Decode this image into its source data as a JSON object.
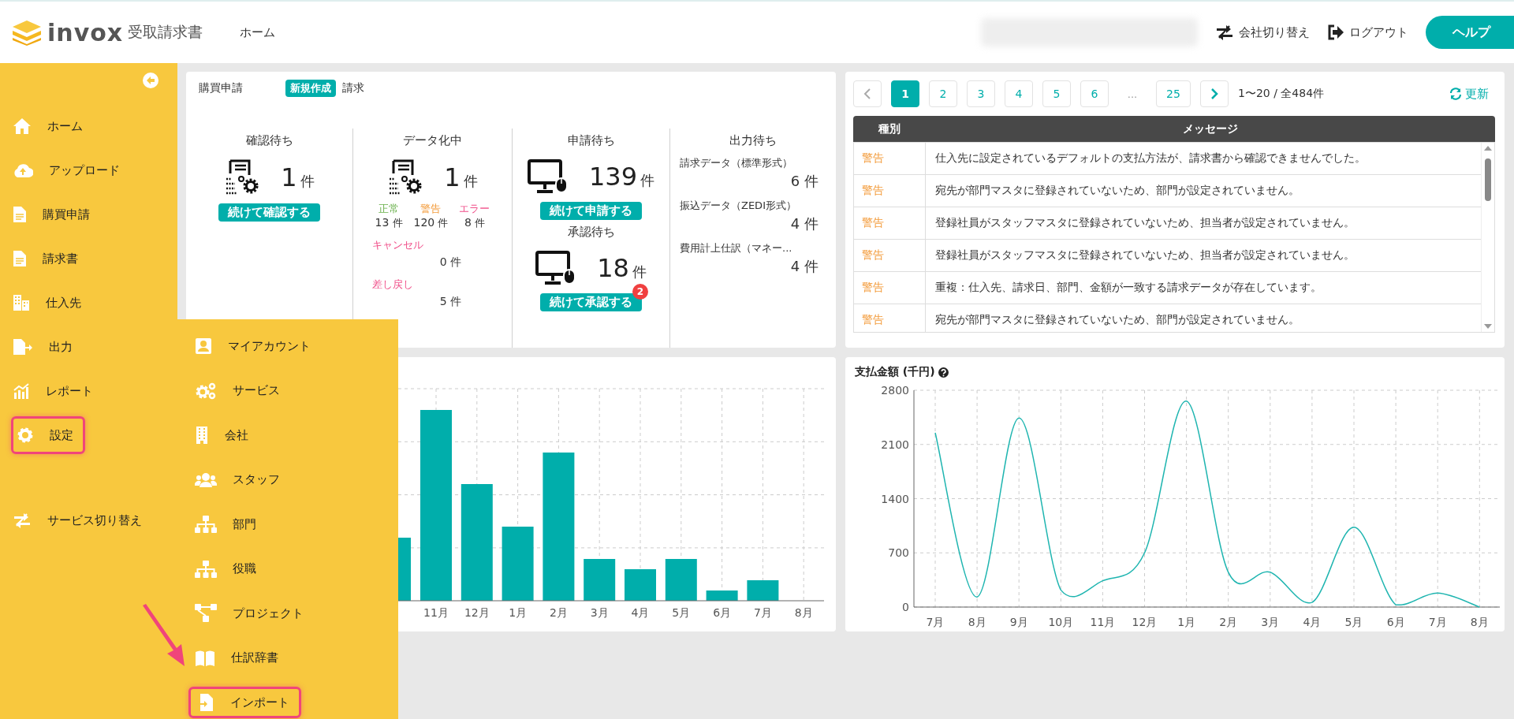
{
  "header": {
    "brand": "invox",
    "product": "受取請求書",
    "nav": [
      {
        "label": "ホーム"
      }
    ],
    "actions": [
      {
        "label": "会社切り替え",
        "kind": "switch"
      },
      {
        "label": "ログアウト",
        "kind": "logout"
      }
    ],
    "help_button": "ヘルプ"
  },
  "sidebar": {
    "items": [
      {
        "label": "ホーム",
        "kind": "home",
        "highlighted": false
      },
      {
        "label": "アップロード",
        "kind": "upload",
        "highlighted": false
      },
      {
        "label": "購買申請",
        "kind": "document",
        "highlighted": false
      },
      {
        "label": "請求書",
        "kind": "document",
        "highlighted": false
      },
      {
        "label": "仕入先",
        "kind": "buildings",
        "highlighted": false
      },
      {
        "label": "出力",
        "kind": "export",
        "highlighted": false
      },
      {
        "label": "レポート",
        "kind": "report",
        "highlighted": false
      },
      {
        "label": "設定",
        "kind": "gear",
        "highlighted": true
      },
      {
        "label": "サービス切り替え",
        "kind": "swap",
        "highlighted": false
      }
    ]
  },
  "settings_menu": {
    "items": [
      {
        "label": "マイアカウント",
        "kind": "account",
        "highlighted": false
      },
      {
        "label": "サービス",
        "kind": "gears",
        "highlighted": false
      },
      {
        "label": "会社",
        "kind": "office",
        "highlighted": false
      },
      {
        "label": "スタッフ",
        "kind": "staff",
        "highlighted": false
      },
      {
        "label": "部門",
        "kind": "org",
        "highlighted": false
      },
      {
        "label": "役職",
        "kind": "org",
        "highlighted": false
      },
      {
        "label": "プロジェクト",
        "kind": "project",
        "highlighted": false
      },
      {
        "label": "仕訳辞書",
        "kind": "book",
        "highlighted": false
      },
      {
        "label": "インポート",
        "kind": "import",
        "highlighted": true
      }
    ]
  },
  "purchase": {
    "title": "購買申請",
    "new_button": "新規作成",
    "status": "確認待ち",
    "count": "1",
    "unit": "件",
    "action": "続けて確認する"
  },
  "invoice": {
    "title": "請求",
    "digitizing": {
      "status": "データ化中",
      "count": "1",
      "unit": "件",
      "breakdown": [
        {
          "label": "正常",
          "count": "13",
          "unit": "件",
          "color": "#6ab04c"
        },
        {
          "label": "警告",
          "count": "120",
          "unit": "件",
          "color": "#f39c3c"
        },
        {
          "label": "エラー",
          "count": "8",
          "unit": "件",
          "color": "#f0508a"
        }
      ],
      "others": [
        {
          "label": "キャンセル",
          "count": "0",
          "unit": "件"
        },
        {
          "label": "差し戻し",
          "count": "5",
          "unit": "件"
        }
      ]
    },
    "awaiting_application": {
      "status": "申請待ち",
      "count": "139",
      "unit": "件",
      "action": "続けて申請する"
    },
    "awaiting_approval": {
      "status": "承認待ち",
      "count": "18",
      "unit": "件",
      "action": "続けて承認する",
      "badge": "2"
    },
    "awaiting_output": {
      "status": "出力待ち",
      "items": [
        {
          "label": "請求データ（標準形式）",
          "count": "6",
          "unit": "件"
        },
        {
          "label": "振込データ（ZEDI形式）",
          "count": "4",
          "unit": "件"
        },
        {
          "label": "費用計上仕訳（マネー...",
          "count": "4",
          "unit": "件"
        }
      ]
    }
  },
  "messages": {
    "pages": [
      {
        "label": "1",
        "kind": "page",
        "selected": true
      },
      {
        "label": "2",
        "kind": "page",
        "selected": false
      },
      {
        "label": "3",
        "kind": "page",
        "selected": false
      },
      {
        "label": "4",
        "kind": "page",
        "selected": false
      },
      {
        "label": "5",
        "kind": "page",
        "selected": false
      },
      {
        "label": "6",
        "kind": "page",
        "selected": false
      },
      {
        "label": "...",
        "kind": "ellipsis",
        "selected": false
      },
      {
        "label": "25",
        "kind": "page",
        "selected": false
      }
    ],
    "range": "1〜20 / 全484件",
    "refresh": "更新",
    "columns": [
      "種別",
      "メッセージ"
    ],
    "rows": [
      {
        "type": "警告",
        "message": "仕入先に設定されているデフォルトの支払方法が、請求書から確認できませんでした。"
      },
      {
        "type": "警告",
        "message": "宛先が部門マスタに登録されていないため、部門が設定されていません。"
      },
      {
        "type": "警告",
        "message": "登録社員がスタッフマスタに登録されていないため、担当者が設定されていません。"
      },
      {
        "type": "警告",
        "message": "登録社員がスタッフマスタに登録されていないため、担当者が設定されていません。"
      },
      {
        "type": "警告",
        "message": "重複：仕入先、請求日、部門、金額が一致する請求データが存在しています。"
      },
      {
        "type": "警告",
        "message": "宛先が部門マスタに登録されていないため、部門が設定されていません。"
      }
    ]
  },
  "bar_chart": {
    "x_labels": [
      "11月",
      "12月",
      "1月",
      "2月",
      "3月",
      "4月",
      "5月",
      "6月",
      "7月",
      "8月"
    ]
  },
  "payment_chart": {
    "chart_data": {
      "type": "line",
      "title": "支払金額 (千円)",
      "categories": [
        "7月",
        "8月",
        "9月",
        "10月",
        "11月",
        "12月",
        "1月",
        "2月",
        "3月",
        "4月",
        "5月",
        "6月",
        "7月",
        "8月"
      ],
      "series": [
        {
          "color": "#1fb5b0",
          "values": [
            2250,
            130,
            2440,
            220,
            340,
            700,
            2660,
            450,
            450,
            60,
            1030,
            30,
            180,
            0
          ]
        }
      ],
      "ylim": [
        0,
        2800
      ],
      "grid": true,
      "yticks": [
        0,
        700,
        1400,
        2100,
        2800
      ]
    }
  }
}
